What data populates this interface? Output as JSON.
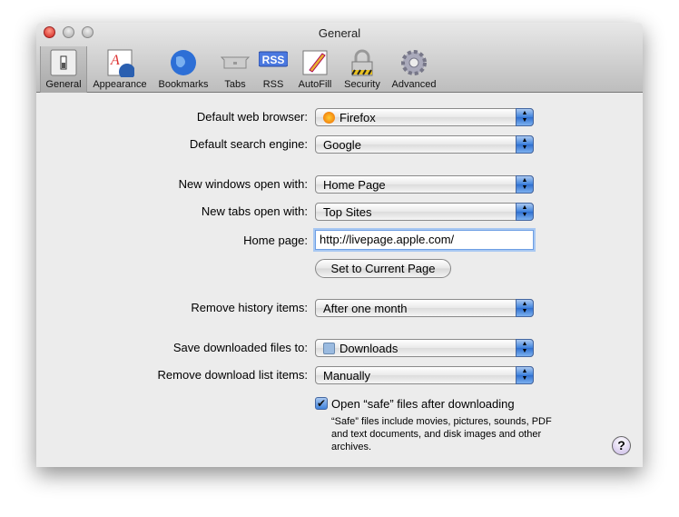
{
  "window": {
    "title": "General"
  },
  "toolbar": [
    {
      "label": "General",
      "icon": "switch-icon"
    },
    {
      "label": "Appearance",
      "icon": "appearance-icon"
    },
    {
      "label": "Bookmarks",
      "icon": "globe-icon"
    },
    {
      "label": "Tabs",
      "icon": "tabs-icon"
    },
    {
      "label": "RSS",
      "icon": "rss-icon",
      "badge": "RSS"
    },
    {
      "label": "AutoFill",
      "icon": "pencil-icon"
    },
    {
      "label": "Security",
      "icon": "lock-icon"
    },
    {
      "label": "Advanced",
      "icon": "gear-icon"
    }
  ],
  "form": {
    "default_browser": {
      "label": "Default web browser:",
      "value": "Firefox"
    },
    "search_engine": {
      "label": "Default search engine:",
      "value": "Google"
    },
    "new_windows": {
      "label": "New windows open with:",
      "value": "Home Page"
    },
    "new_tabs": {
      "label": "New tabs open with:",
      "value": "Top Sites"
    },
    "home_page": {
      "label": "Home page:",
      "value": "http://livepage.apple.com/"
    },
    "set_current": "Set to Current Page",
    "remove_history": {
      "label": "Remove history items:",
      "value": "After one month"
    },
    "save_downloads": {
      "label": "Save downloaded files to:",
      "value": "Downloads"
    },
    "remove_downloads": {
      "label": "Remove download list items:",
      "value": "Manually"
    },
    "open_safe": {
      "label": "Open “safe” files after downloading",
      "checked": true
    },
    "note": "“Safe” files include movies, pictures, sounds, PDF and text documents, and disk images and other archives."
  },
  "help": "?"
}
